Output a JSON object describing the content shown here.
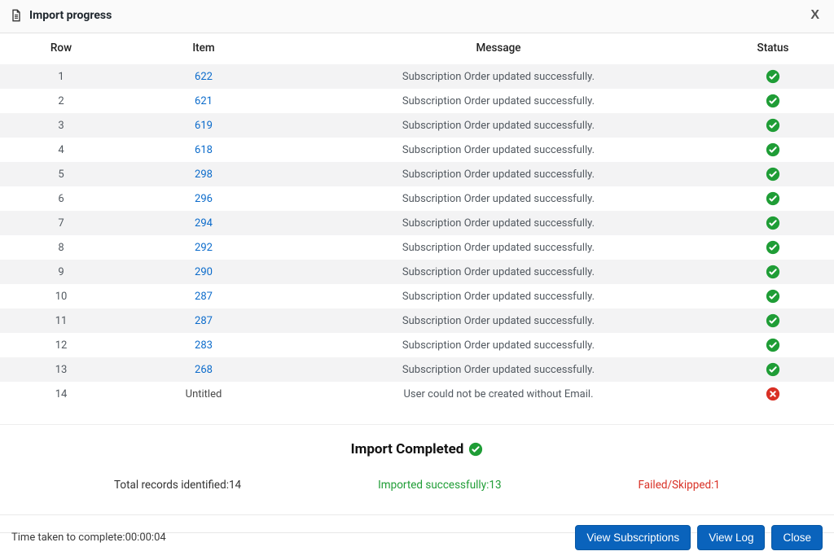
{
  "header": {
    "title": "Import progress",
    "close_label": "X"
  },
  "columns": {
    "row": "Row",
    "item": "Item",
    "message": "Message",
    "status": "Status"
  },
  "rows": [
    {
      "row": "1",
      "item": "622",
      "link": true,
      "message": "Subscription Order updated successfully.",
      "status": "ok"
    },
    {
      "row": "2",
      "item": "621",
      "link": true,
      "message": "Subscription Order updated successfully.",
      "status": "ok"
    },
    {
      "row": "3",
      "item": "619",
      "link": true,
      "message": "Subscription Order updated successfully.",
      "status": "ok"
    },
    {
      "row": "4",
      "item": "618",
      "link": true,
      "message": "Subscription Order updated successfully.",
      "status": "ok"
    },
    {
      "row": "5",
      "item": "298",
      "link": true,
      "message": "Subscription Order updated successfully.",
      "status": "ok"
    },
    {
      "row": "6",
      "item": "296",
      "link": true,
      "message": "Subscription Order updated successfully.",
      "status": "ok"
    },
    {
      "row": "7",
      "item": "294",
      "link": true,
      "message": "Subscription Order updated successfully.",
      "status": "ok"
    },
    {
      "row": "8",
      "item": "292",
      "link": true,
      "message": "Subscription Order updated successfully.",
      "status": "ok"
    },
    {
      "row": "9",
      "item": "290",
      "link": true,
      "message": "Subscription Order updated successfully.",
      "status": "ok"
    },
    {
      "row": "10",
      "item": "287",
      "link": true,
      "message": "Subscription Order updated successfully.",
      "status": "ok"
    },
    {
      "row": "11",
      "item": "287",
      "link": true,
      "message": "Subscription Order updated successfully.",
      "status": "ok"
    },
    {
      "row": "12",
      "item": "283",
      "link": true,
      "message": "Subscription Order updated successfully.",
      "status": "ok"
    },
    {
      "row": "13",
      "item": "268",
      "link": true,
      "message": "Subscription Order updated successfully.",
      "status": "ok"
    },
    {
      "row": "14",
      "item": "Untitled",
      "link": false,
      "message": "User could not be created without Email.",
      "status": "fail"
    }
  ],
  "summary": {
    "title": "Import Completed",
    "total_label": "Total records identified:",
    "total_value": "14",
    "ok_label": "Imported successfully:",
    "ok_value": "13",
    "fail_label": "Failed/Skipped:",
    "fail_value": "1"
  },
  "footer": {
    "time_label": "Time taken to complete:",
    "time_value": "00:00:04",
    "view_subscriptions": "View Subscriptions",
    "view_log": "View Log",
    "close": "Close"
  }
}
